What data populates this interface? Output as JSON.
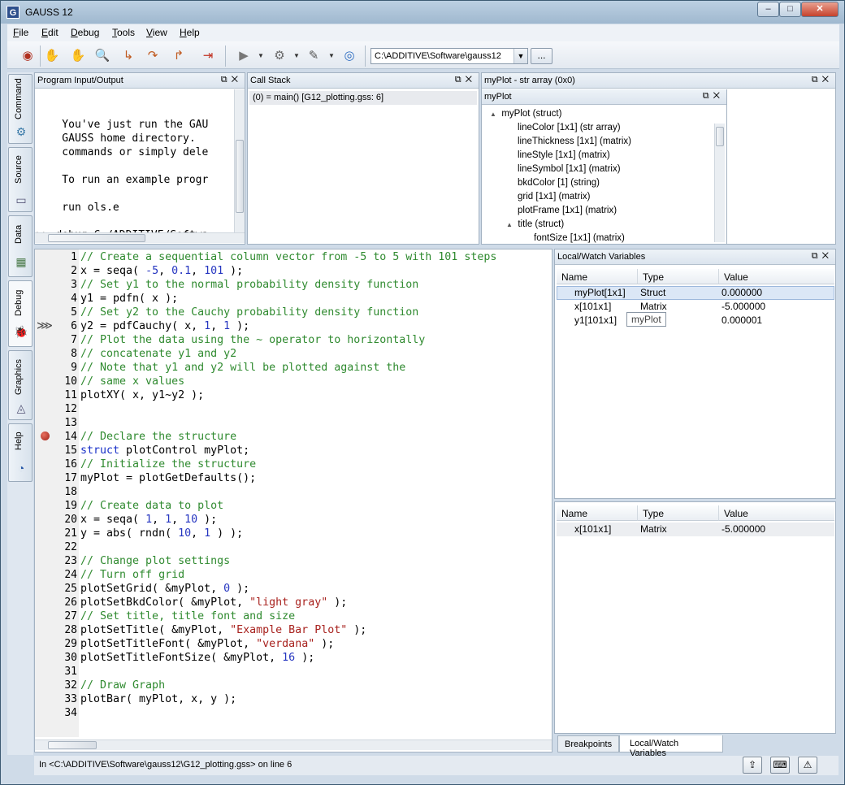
{
  "window": {
    "title": "GAUSS 12",
    "app_icon": "G",
    "min": "–",
    "max": "□",
    "close": "✕"
  },
  "menu": {
    "items": [
      {
        "label": "File",
        "accel": "F",
        "rest": "ile"
      },
      {
        "label": "Edit",
        "accel": "E",
        "rest": "dit"
      },
      {
        "label": "Debug",
        "accel": "D",
        "rest": "ebug"
      },
      {
        "label": "Tools",
        "accel": "T",
        "rest": "ools"
      },
      {
        "label": "View",
        "accel": "V",
        "rest": "iew"
      },
      {
        "label": "Help",
        "accel": "H",
        "rest": "elp"
      }
    ]
  },
  "toolbar": {
    "working_dir": "C:\\ADDITIVE\\Software\\gauss12",
    "browse_label": "...",
    "icons": [
      "lifebuoy-icon",
      "hand-icon",
      "hand-gear-icon",
      "magnifier-icon",
      "step-into-icon",
      "step-over-icon",
      "step-out-icon",
      "run-to-cursor-icon",
      "run-icon",
      "gear-run-icon",
      "edit-icon",
      "stop-icon"
    ]
  },
  "sidebar": {
    "tabs": [
      "Command",
      "Source",
      "Data",
      "Debug",
      "Graphics",
      "Help"
    ]
  },
  "program_io": {
    "title": "Program Input/Output",
    "lines": [
      "    You've just run the GAU",
      "    GAUSS home directory.",
      "    commands or simply dele",
      "",
      "    To run an example progr",
      "",
      "    run ols.e",
      "",
      ">> debug C:/ADDITIVE/Softwa"
    ]
  },
  "call_stack": {
    "title": "Call Stack",
    "entries": [
      "(0) = main() [G12_plotting.gss: 6]"
    ]
  },
  "struct_view": {
    "title": "myPlot - str array (0x0)",
    "inner_title": "myPlot",
    "tree": [
      {
        "label": "myPlot (struct)",
        "level": 0,
        "expander": "▲"
      },
      {
        "label": "lineColor [1x1] (str array)",
        "level": 1
      },
      {
        "label": "lineThickness [1x1] (matrix)",
        "level": 1
      },
      {
        "label": "lineStyle [1x1] (matrix)",
        "level": 1
      },
      {
        "label": "lineSymbol [1x1] (matrix)",
        "level": 1
      },
      {
        "label": "bkdColor [1] (string)",
        "level": 1
      },
      {
        "label": "grid [1x1] (matrix)",
        "level": 1
      },
      {
        "label": "plotFrame [1x1] (matrix)",
        "level": 1
      },
      {
        "label": "title (struct)",
        "level": 1,
        "expander": "▲"
      },
      {
        "label": "fontSize [1x1] (matrix)",
        "level": 2
      }
    ]
  },
  "editor": {
    "lines": [
      {
        "n": "1",
        "html": "<span class='cmt'>// Create a sequential column vector from -5 to 5 with 101 steps</span>"
      },
      {
        "n": "2",
        "html": "x = seqa( <span class='num'>-5</span>, <span class='num'>0.1</span>, <span class='num'>101</span> );"
      },
      {
        "n": "3",
        "html": "<span class='cmt'>// Set y1 to the normal probability density function</span>"
      },
      {
        "n": "4",
        "html": "y1 = pdfn( x );"
      },
      {
        "n": "5",
        "html": "<span class='cmt'>// Set y2 to the Cauchy probability density function</span>"
      },
      {
        "n": "6",
        "html": "y2 = pdfCauchy( x, <span class='num'>1</span>, <span class='num'>1</span> );"
      },
      {
        "n": "7",
        "html": "<span class='cmt'>// Plot the data using the ~ operator to horizontally</span>"
      },
      {
        "n": "8",
        "html": "<span class='cmt'>// concatenate y1 and y2</span>"
      },
      {
        "n": "9",
        "html": "<span class='cmt'>// Note that y1 and y2 will be plotted against the</span>"
      },
      {
        "n": "10",
        "html": "<span class='cmt'>// same x values</span>"
      },
      {
        "n": "11",
        "html": "plotXY( x, y1~y2 );"
      },
      {
        "n": "12",
        "html": ""
      },
      {
        "n": "13",
        "html": ""
      },
      {
        "n": "14",
        "html": "<span class='cmt'>// Declare the structure</span>"
      },
      {
        "n": "15",
        "html": "<span class='kw'>struct</span> plotControl myPlot;"
      },
      {
        "n": "16",
        "html": "<span class='cmt'>// Initialize the structure</span>"
      },
      {
        "n": "17",
        "html": "myPlot = plotGetDefaults();"
      },
      {
        "n": "18",
        "html": ""
      },
      {
        "n": "19",
        "html": "<span class='cmt'>// Create data to plot</span>"
      },
      {
        "n": "20",
        "html": "x = seqa( <span class='num'>1</span>, <span class='num'>1</span>, <span class='num'>10</span> );"
      },
      {
        "n": "21",
        "html": "y = abs( rndn( <span class='num'>10</span>, <span class='num'>1</span> ) );"
      },
      {
        "n": "22",
        "html": ""
      },
      {
        "n": "23",
        "html": "<span class='cmt'>// Change plot settings</span>"
      },
      {
        "n": "24",
        "html": "<span class='cmt'>// Turn off grid</span>"
      },
      {
        "n": "25",
        "html": "plotSetGrid( &amp;myPlot, <span class='num'>0</span> );"
      },
      {
        "n": "26",
        "html": "plotSetBkdColor( &amp;myPlot, <span class='str'>\"light gray\"</span> );"
      },
      {
        "n": "27",
        "html": "<span class='cmt'>// Set title, title font and size</span>"
      },
      {
        "n": "28",
        "html": "plotSetTitle( &amp;myPlot, <span class='str'>\"Example Bar Plot\"</span> );"
      },
      {
        "n": "29",
        "html": "plotSetTitleFont( &amp;myPlot, <span class='str'>\"verdana\"</span> );"
      },
      {
        "n": "30",
        "html": "plotSetTitleFontSize( &amp;myPlot, <span class='num'>16</span> );"
      },
      {
        "n": "31",
        "html": ""
      },
      {
        "n": "32",
        "html": "<span class='cmt'>// Draw Graph</span>"
      },
      {
        "n": "33",
        "html": "plotBar( myPlot, x, y );"
      },
      {
        "n": "34",
        "html": ""
      }
    ],
    "current_line_marker": "⋙"
  },
  "locals": {
    "title": "Local/Watch Variables",
    "columns": [
      "Name",
      "Type",
      "Value"
    ],
    "rows": [
      {
        "name": "myPlot[1x1]",
        "type": "Struct",
        "value": "0.000000"
      },
      {
        "name": "x[101x1]",
        "type": "Matrix",
        "value": "-5.000000"
      },
      {
        "name": "y1[101x1]",
        "type": "",
        "value": "0.000001"
      }
    ],
    "tooltip": "myPlot"
  },
  "watch": {
    "columns": [
      "Name",
      "Type",
      "Value"
    ],
    "rows": [
      {
        "name": "x[101x1]",
        "type": "Matrix",
        "value": "-5.000000"
      }
    ]
  },
  "bottom_tabs": [
    "Breakpoints",
    "Local/Watch Variables"
  ],
  "status": {
    "text": "In <C:\\ADDITIVE\\Software\\gauss12\\G12_plotting.gss> on line 6"
  }
}
